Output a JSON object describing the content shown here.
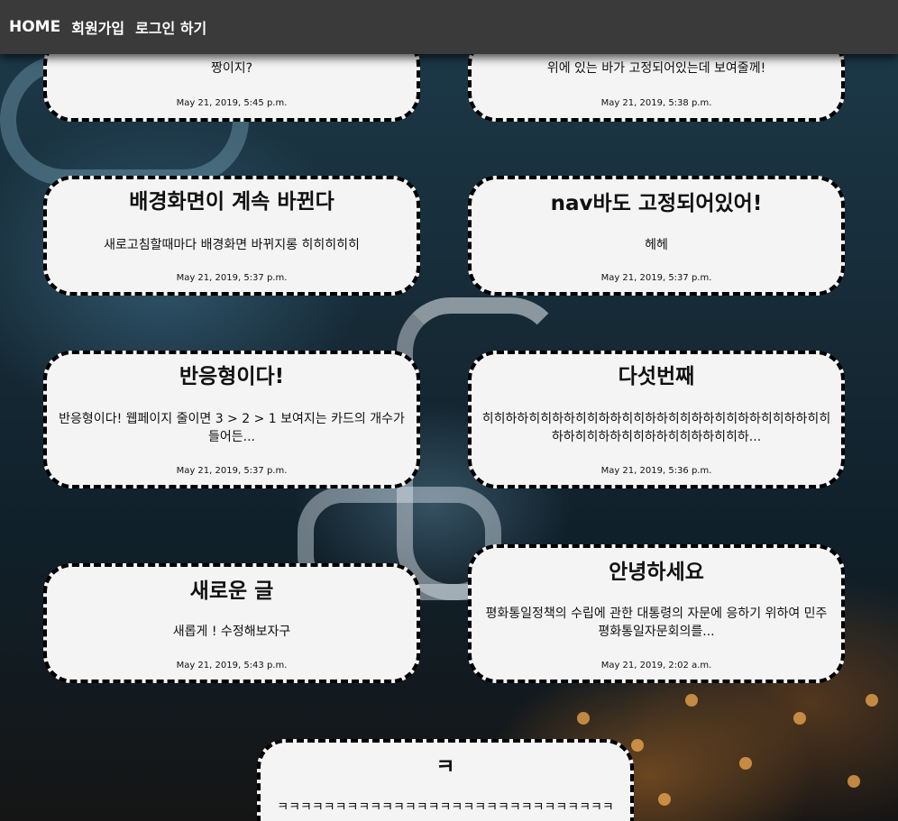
{
  "nav": {
    "home": "HOME",
    "signup": "회원가입",
    "login": "로그인 하기"
  },
  "cards": [
    {
      "title": "",
      "body": "짱이지?",
      "date": "May 21, 2019, 5:45 p.m."
    },
    {
      "title": "",
      "body": "위에 있는 바가 고정되어있는데 보여줄께!",
      "date": "May 21, 2019, 5:38 p.m."
    },
    {
      "title": "배경화면이 계속 바뀐다",
      "body": "새로고침할때마다 배경화면 바뀌지롱 히히히히히",
      "date": "May 21, 2019, 5:37 p.m."
    },
    {
      "title": "nav바도 고정되어있어!",
      "body": "헤헤",
      "date": "May 21, 2019, 5:37 p.m."
    },
    {
      "title": "반응형이다!",
      "body": "반응형이다! 웹페이지 줄이면 3 > 2 > 1 보여지는 카드의 개수가 들어든...",
      "date": "May 21, 2019, 5:37 p.m."
    },
    {
      "title": "다섯번째",
      "body": "히히하하히히하하히히하하히히하하히히하하히히하하히히하하히히하하히히하하히히하하히히하하히히하...",
      "date": "May 21, 2019, 5:36 p.m."
    },
    {
      "title": "새로운 글",
      "body": "새롭게 ! 수정해보자구",
      "date": "May 21, 2019, 5:43 p.m."
    },
    {
      "title": "안녕하세요",
      "body": "평화통일정책의 수립에 관한 대통령의 자문에 응하기 위하여 민주평화통일자문회의를...",
      "date": "May 21, 2019, 2:02 a.m."
    },
    {
      "title": "ㅋ",
      "body": "ㅋㅋㅋㅋㅋㅋㅋㅋㅋㅋㅋㅋㅋㅋㅋㅋㅋㅋㅋㅋㅋㅋㅋㅋㅋㅋㅋㅋㅋ",
      "date": ""
    }
  ]
}
